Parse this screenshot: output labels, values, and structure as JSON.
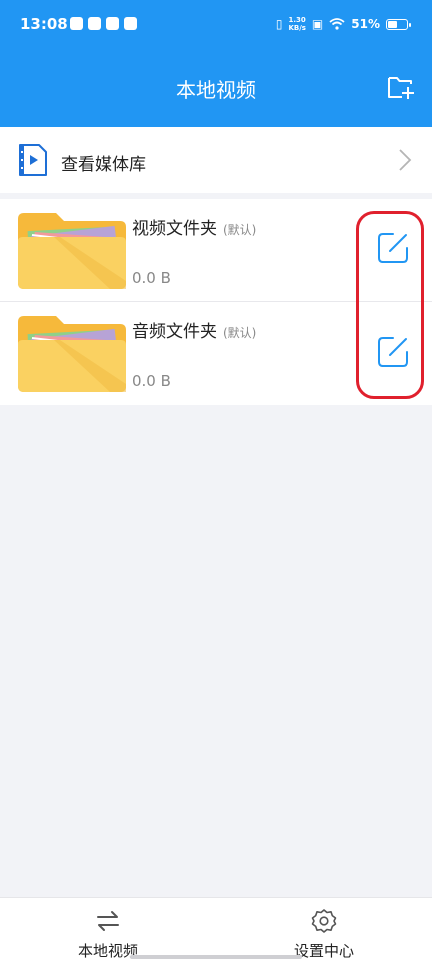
{
  "status_bar": {
    "time": "13:08",
    "net_speed_value": "1.30",
    "net_speed_unit": "KB/s",
    "battery_level": "51%",
    "battery_fraction": 0.51
  },
  "app_bar": {
    "title": "本地视频",
    "add_folder_icon": "folder-add-icon",
    "color": "#2196f3"
  },
  "media_library": {
    "label": "查看媒体库",
    "icon": "video-file-icon"
  },
  "folders": [
    {
      "name": "视频文件夹",
      "tag": "(默认)",
      "size": "0.0 B",
      "edit_icon": "edit-icon"
    },
    {
      "name": "音频文件夹",
      "tag": "(默认)",
      "size": "0.0 B",
      "edit_icon": "edit-icon"
    }
  ],
  "bottom_nav": {
    "items": [
      {
        "label": "本地视频",
        "icon": "swap-arrows-icon"
      },
      {
        "label": "设置中心",
        "icon": "gear-icon"
      }
    ]
  },
  "colors": {
    "accent": "#2196f3",
    "highlight": "#e0202d",
    "folder": "#f9c74f"
  }
}
